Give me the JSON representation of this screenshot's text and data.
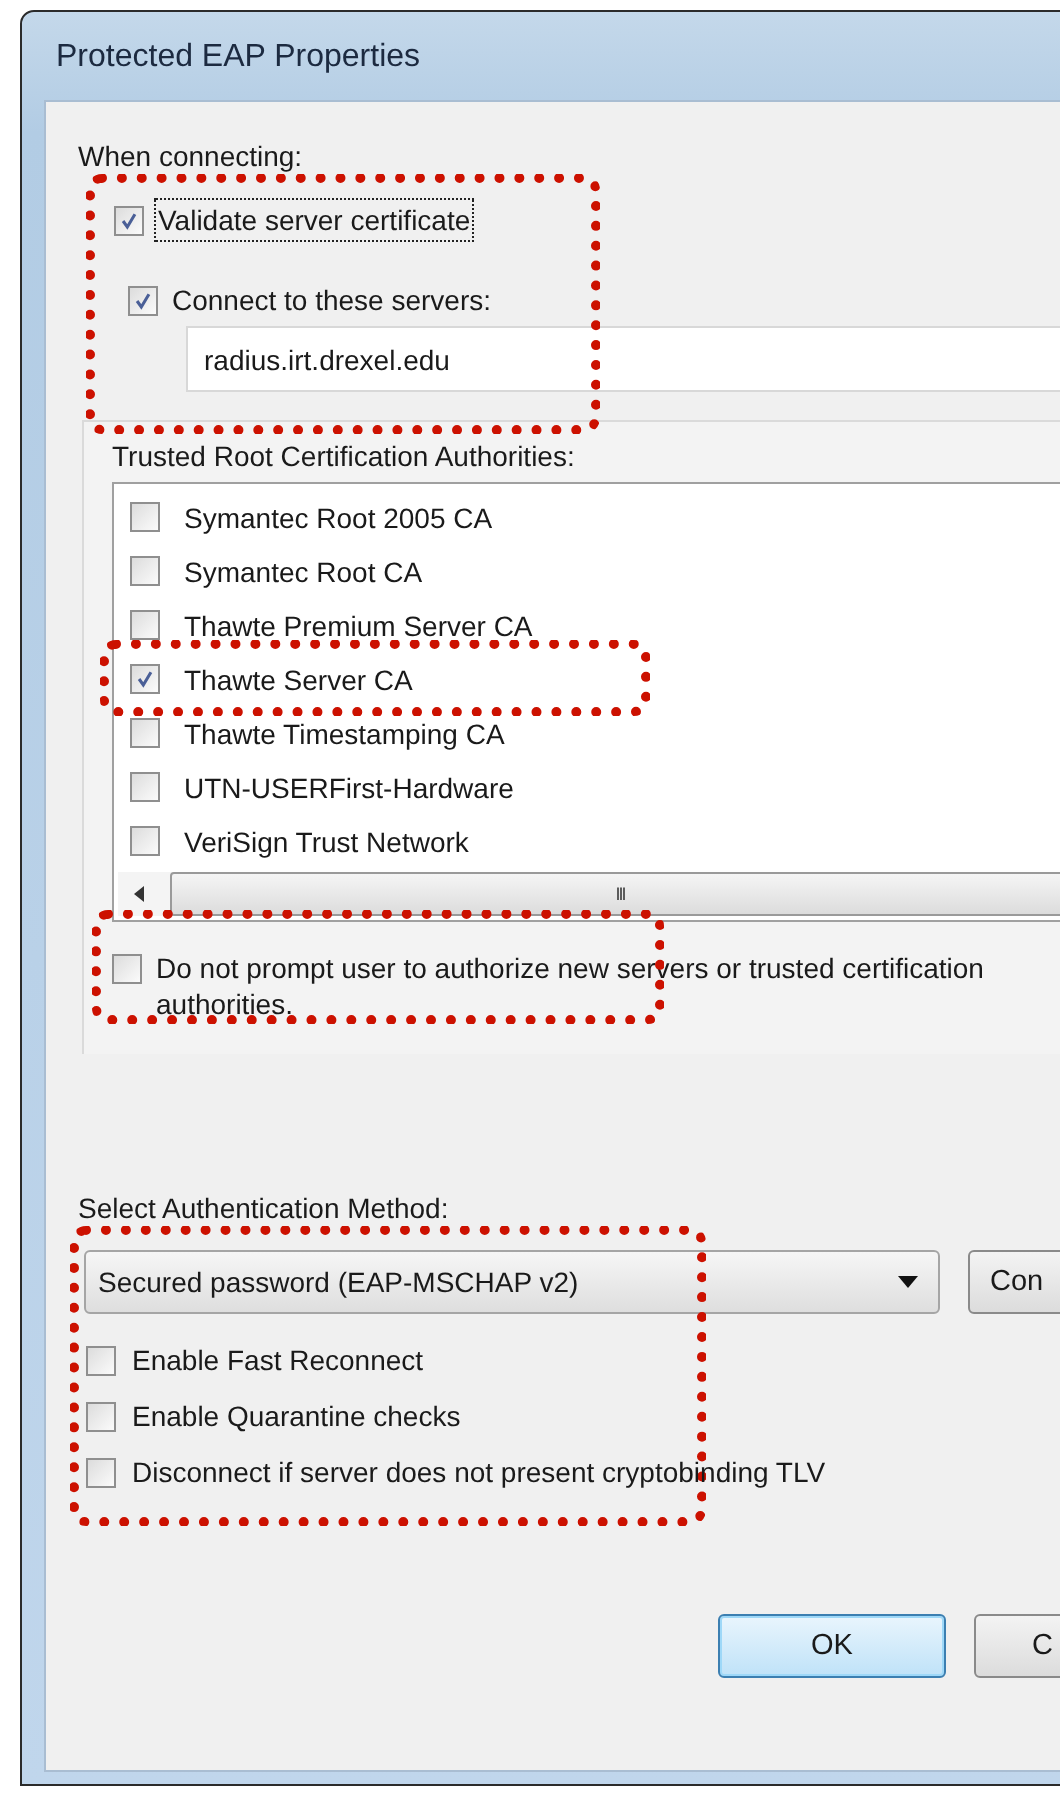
{
  "window": {
    "title": "Protected EAP Properties"
  },
  "when_connecting": {
    "label": "When connecting:",
    "highlighted": true,
    "validate": {
      "label": "Validate server certificate",
      "checked": true,
      "focused": true
    },
    "connect": {
      "label": "Connect to these servers:",
      "checked": true
    },
    "servers_field": {
      "value": "radius.irt.drexel.edu"
    }
  },
  "trusted_roots": {
    "label": "Trusted Root Certification Authorities:",
    "items": [
      {
        "label": "Symantec Root 2005 CA",
        "checked": false,
        "highlighted": false
      },
      {
        "label": "Symantec Root CA",
        "checked": false,
        "highlighted": false
      },
      {
        "label": "Thawte Premium Server CA",
        "checked": false,
        "highlighted": false
      },
      {
        "label": "Thawte Server CA",
        "checked": true,
        "highlighted": true
      },
      {
        "label": "Thawte Timestamping CA",
        "checked": false,
        "highlighted": false
      },
      {
        "label": "UTN-USERFirst-Hardware",
        "checked": false,
        "highlighted": false
      },
      {
        "label": "VeriSign Trust Network",
        "checked": false,
        "highlighted": false
      }
    ],
    "scrollbar_grip": "III"
  },
  "do_not_prompt": {
    "label": "Do not prompt user to authorize new servers or trusted certification authorities.",
    "checked": false,
    "highlighted": true
  },
  "authentication": {
    "label": "Select Authentication Method:",
    "highlighted": true,
    "method": {
      "value": "Secured password (EAP-MSCHAP v2)"
    },
    "configure_button": "Con",
    "options": [
      {
        "label": "Enable Fast Reconnect",
        "checked": false
      },
      {
        "label": "Enable Quarantine checks",
        "checked": false
      },
      {
        "label": "Disconnect if server does not present cryptobinding TLV",
        "checked": false
      }
    ]
  },
  "buttons": [
    {
      "label": "OK",
      "default": true
    },
    {
      "label": "C",
      "default": false
    }
  ]
}
